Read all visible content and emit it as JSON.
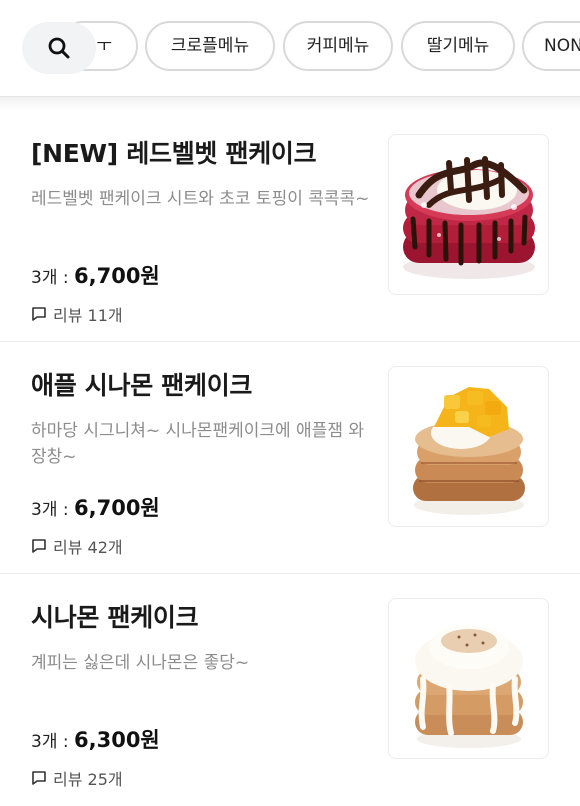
{
  "search": {
    "icon": "search-icon"
  },
  "categories": [
    {
      "label": "ㅜ",
      "partial": true
    },
    {
      "label": "크로플메뉴"
    },
    {
      "label": "커피메뉴"
    },
    {
      "label": "딸기메뉴"
    },
    {
      "label": "NON"
    }
  ],
  "menu_items": [
    {
      "title": "[NEW] 레드벨벳 팬케이크",
      "description": "레드벨벳 팬케이크 시트와 초코 토핑이 콕콕콕~",
      "qty": "3개 :",
      "price": "6,700원",
      "review": "리뷰 11개",
      "image": "red-velvet-pancake-image"
    },
    {
      "title": "애플 시나몬 팬케이크",
      "description": "하마당 시그니쳐~ 시나몬팬케이크에 애플잼 와장창~",
      "qty": "3개 :",
      "price": "6,700원",
      "review": "리뷰 42개",
      "image": "apple-cinnamon-pancake-image"
    },
    {
      "title": "시나몬 팬케이크",
      "description": "계피는 싫은데 시나몬은 좋당~",
      "qty": "3개 :",
      "price": "6,300원",
      "review": "리뷰 25개",
      "image": "cinnamon-pancake-image"
    }
  ],
  "colors": {
    "accent": "#111111",
    "muted": "#8c8c8c",
    "border": "#d9d9d9",
    "search_bg": "#f2f3f5"
  }
}
